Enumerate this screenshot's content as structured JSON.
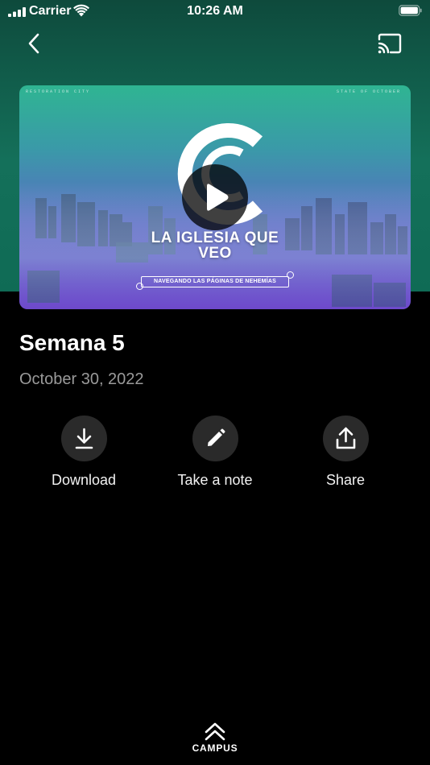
{
  "status_bar": {
    "carrier": "Carrier",
    "time": "10:26 AM",
    "icons": [
      "cellular-signal-icon",
      "wifi-icon",
      "battery-icon"
    ]
  },
  "nav": {
    "back_icon": "chevron-left-icon",
    "cast_icon": "cast-icon"
  },
  "video": {
    "corner_left": "RESTORATION CITY",
    "corner_right": "STATE OF OCTOBER",
    "title_line1": "LA IGLESIA QUE",
    "title_line2": "VEO",
    "subtitle": "NAVEGANDO LAS PÁGINAS DE NEHEMÍAS",
    "play_icon": "play-icon"
  },
  "sermon": {
    "title": "Semana 5",
    "date": "October 30, 2022"
  },
  "actions": [
    {
      "label": "Download",
      "icon": "download-icon"
    },
    {
      "label": "Take a note",
      "icon": "pencil-icon"
    },
    {
      "label": "Share",
      "icon": "share-icon"
    }
  ],
  "bottom": {
    "label": "CAMPUS",
    "icon": "double-chevron-up-icon"
  },
  "colors": {
    "background": "#000000",
    "hero_green": "#14705a",
    "button_bg": "#2a2a2a",
    "muted_text": "#9a9a9a"
  }
}
